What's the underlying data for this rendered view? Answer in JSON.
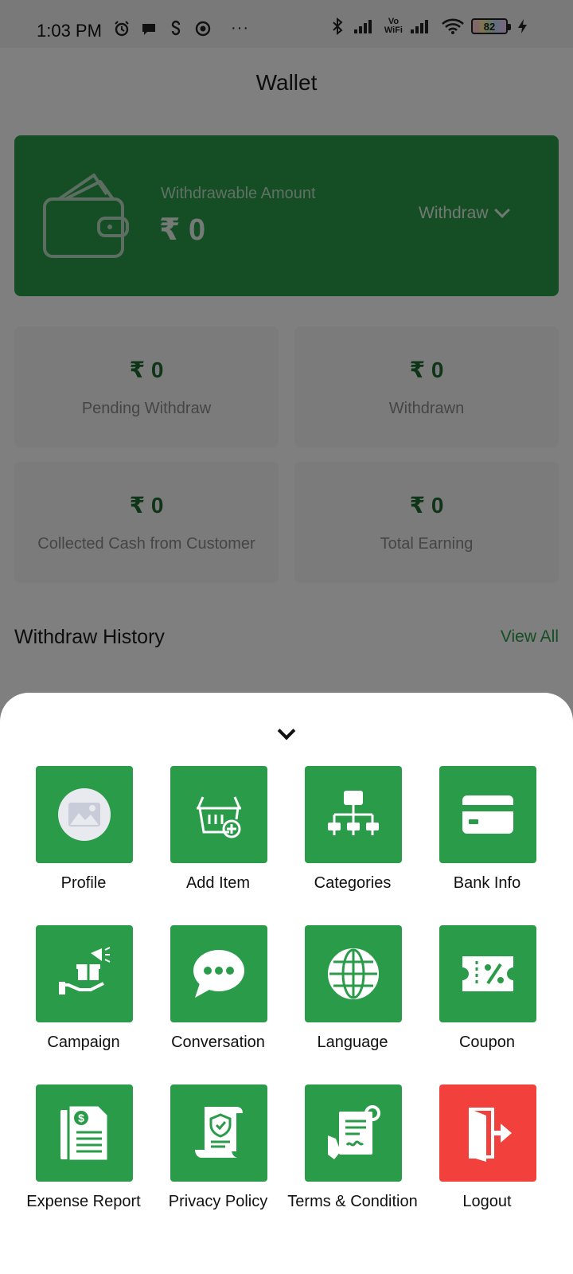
{
  "status_bar": {
    "time": "1:03 PM",
    "battery": "82",
    "vowifi_top": "Vo",
    "vowifi_bottom": "WiFi",
    "overflow": "···"
  },
  "header": {
    "title": "Wallet"
  },
  "wallet": {
    "label": "Withdrawable Amount",
    "amount": "₹ 0",
    "withdraw_label": "Withdraw"
  },
  "stats": [
    {
      "value": "₹ 0",
      "label": "Pending Withdraw"
    },
    {
      "value": "₹ 0",
      "label": "Withdrawn"
    },
    {
      "value": "₹ 0",
      "label": "Collected Cash from Customer"
    },
    {
      "value": "₹ 0",
      "label": "Total Earning"
    }
  ],
  "history": {
    "title": "Withdraw History",
    "view_all": "View All"
  },
  "menu": {
    "items": [
      {
        "label": "Profile",
        "icon": "profile-image-icon"
      },
      {
        "label": "Add Item",
        "icon": "basket-add-icon"
      },
      {
        "label": "Categories",
        "icon": "hierarchy-icon"
      },
      {
        "label": "Bank Info",
        "icon": "card-icon"
      },
      {
        "label": "Campaign",
        "icon": "gift-megaphone-icon"
      },
      {
        "label": "Conversation",
        "icon": "chat-bubble-icon"
      },
      {
        "label": "Language",
        "icon": "globe-icon"
      },
      {
        "label": "Coupon",
        "icon": "coupon-icon"
      },
      {
        "label": "Expense Report",
        "icon": "report-icon"
      },
      {
        "label": "Privacy Policy",
        "icon": "shield-document-icon"
      },
      {
        "label": "Terms & Condition",
        "icon": "contract-icon"
      },
      {
        "label": "Logout",
        "icon": "logout-door-icon"
      }
    ]
  },
  "colors": {
    "brand_green": "#2a9b48",
    "logout_red": "#f2413c",
    "dim_overlay": "rgba(0,0,0,0.5)"
  }
}
